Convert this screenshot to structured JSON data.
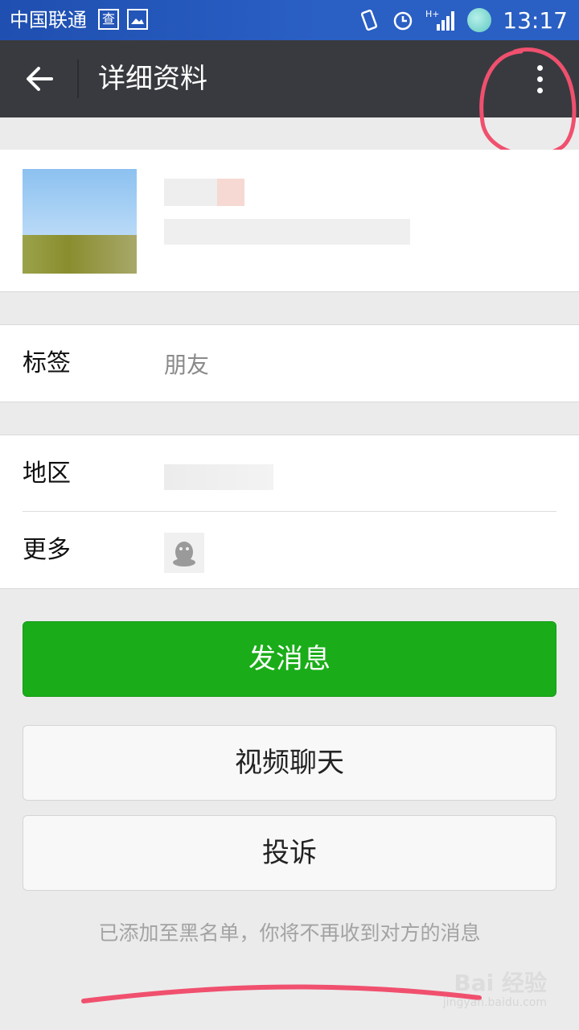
{
  "status_bar": {
    "carrier": "中国联通",
    "badge": "查",
    "time": "13:17"
  },
  "header": {
    "title": "详细资料"
  },
  "rows": {
    "tag_label": "标签",
    "tag_value": "朋友",
    "region_label": "地区",
    "more_label": "更多"
  },
  "buttons": {
    "send_message": "发消息",
    "video_call": "视频聊天",
    "report": "投诉"
  },
  "note": "已添加至黑名单，你将不再收到对方的消息",
  "watermark": {
    "text": "Bai 经验",
    "sub": "jingyan.baidu.com"
  },
  "colors": {
    "titlebar": "#393a3f",
    "primary_button": "#1aad19",
    "statusbar": "#2a5fc4"
  }
}
